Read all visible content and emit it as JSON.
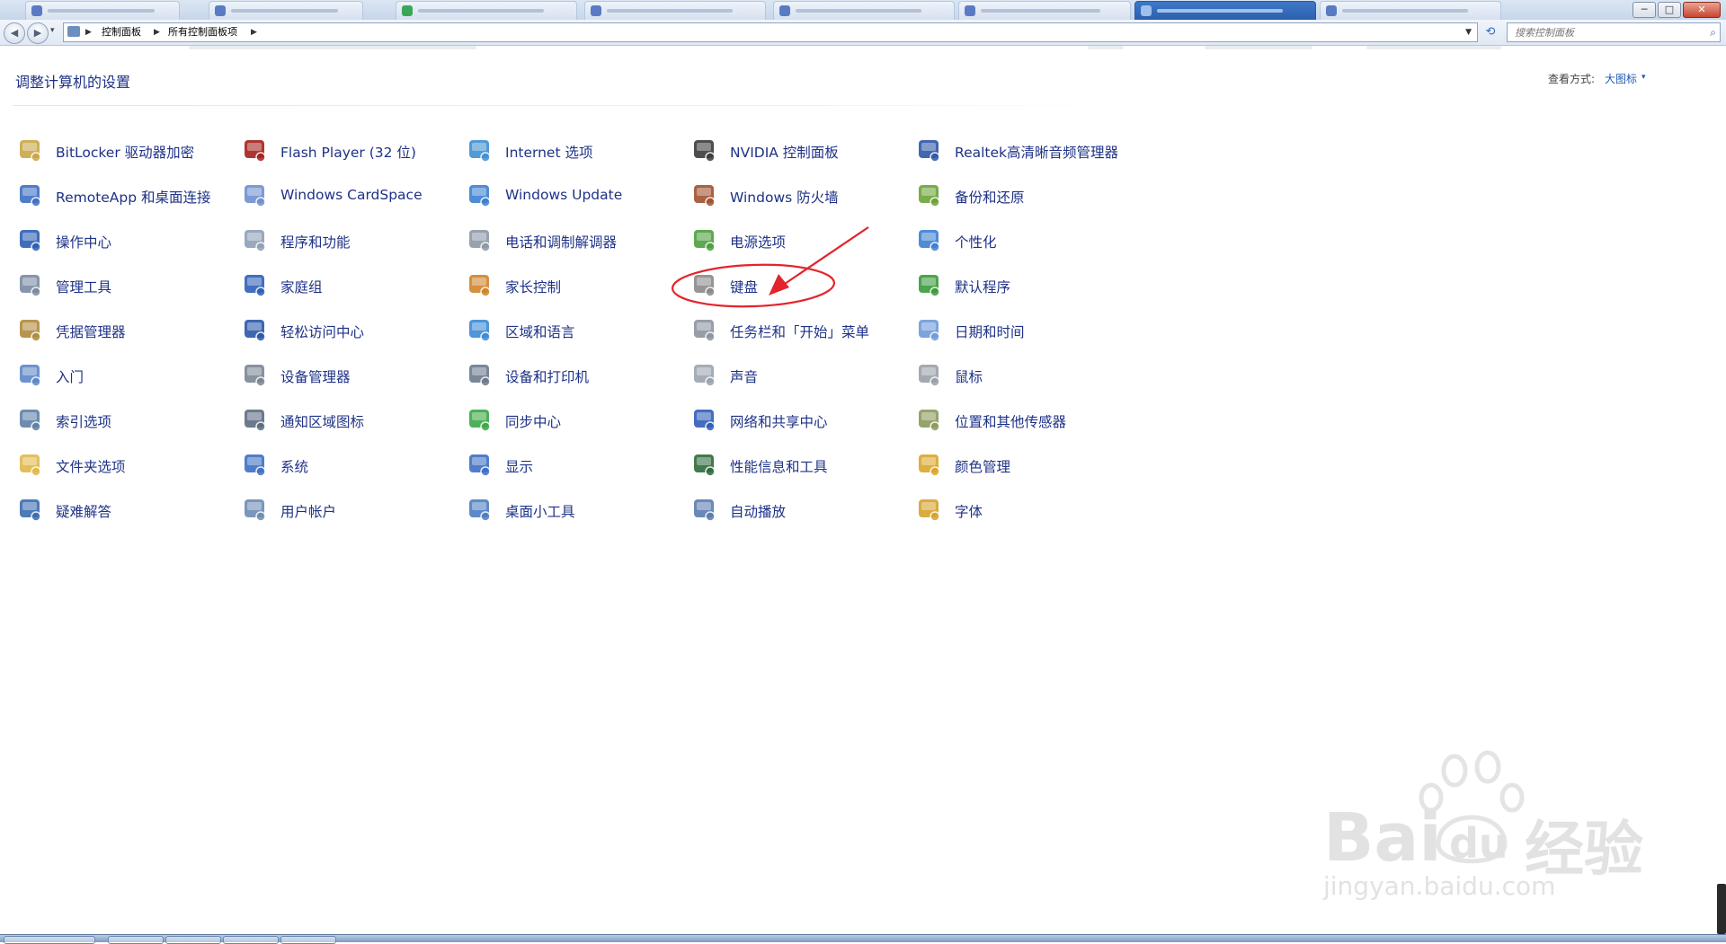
{
  "window": {
    "controls": {
      "minimize": "─",
      "maximize": "□",
      "close": "✕"
    }
  },
  "address_bar": {
    "back_symbol": "◀",
    "forward_symbol": "▶",
    "crumbs": [
      "控制面板",
      "所有控制面板项"
    ],
    "search_placeholder": "搜索控制面板",
    "search_icon": "magnifier-icon",
    "refresh_icon": "refresh-icon"
  },
  "header": {
    "title": "调整计算机的设置",
    "view_by_label": "查看方式:",
    "view_by_value": "大图标",
    "view_by_arrow": "▾"
  },
  "items": [
    [
      "BitLocker 驱动器加密",
      "RemoteApp 和桌面连接",
      "操作中心",
      "管理工具",
      "凭据管理器",
      "入门",
      "索引选项",
      "文件夹选项",
      "疑难解答"
    ],
    [
      "Flash Player (32 位)",
      "Windows CardSpace",
      "程序和功能",
      "家庭组",
      "轻松访问中心",
      "设备管理器",
      "通知区域图标",
      "系统",
      "用户帐户"
    ],
    [
      "Internet 选项",
      "Windows Update",
      "电话和调制解调器",
      "家长控制",
      "区域和语言",
      "设备和打印机",
      "同步中心",
      "显示",
      "桌面小工具"
    ],
    [
      "NVIDIA 控制面板",
      "Windows 防火墙",
      "电源选项",
      "键盘",
      "任务栏和「开始」菜单",
      "声音",
      "网络和共享中心",
      "性能信息和工具",
      "自动播放"
    ],
    [
      "Realtek高清晰音频管理器",
      "备份和还原",
      "个性化",
      "默认程序",
      "日期和时间",
      "鼠标",
      "位置和其他传感器",
      "颜色管理",
      "字体"
    ]
  ],
  "item_icons": [
    [
      "key-icon",
      "remote-desktop-icon",
      "flag-icon",
      "tools-icon",
      "vault-icon",
      "getting-started-icon",
      "magnifier-icon",
      "folder-icon",
      "troubleshoot-icon"
    ],
    [
      "flash-icon",
      "cardspace-icon",
      "programs-icon",
      "homegroup-icon",
      "accessibility-icon",
      "device-manager-icon",
      "tray-icon",
      "computer-icon",
      "users-icon"
    ],
    [
      "globe-icon",
      "update-icon",
      "phone-icon",
      "parental-icon",
      "region-icon",
      "printer-icon",
      "sync-icon",
      "monitor-icon",
      "gadgets-icon"
    ],
    [
      "nvidia-icon",
      "firewall-icon",
      "power-icon",
      "keyboard-icon",
      "taskbar-icon",
      "speaker-icon",
      "network-icon",
      "performance-icon",
      "autoplay-icon"
    ],
    [
      "audio-manager-icon",
      "backup-icon",
      "personalize-icon",
      "default-programs-icon",
      "calendar-clock-icon",
      "mouse-icon",
      "sensor-icon",
      "color-icon",
      "fonts-icon"
    ]
  ],
  "highlight": {
    "item": "键盘",
    "color": "#e4242b"
  },
  "watermark": {
    "brand": "Bai",
    "brand2": "du",
    "cn": "经验",
    "url": "jingyan.baidu.com"
  },
  "colors": {
    "link": "#1e3287",
    "accent": "#1e5bb5",
    "annotation": "#e4242b"
  }
}
